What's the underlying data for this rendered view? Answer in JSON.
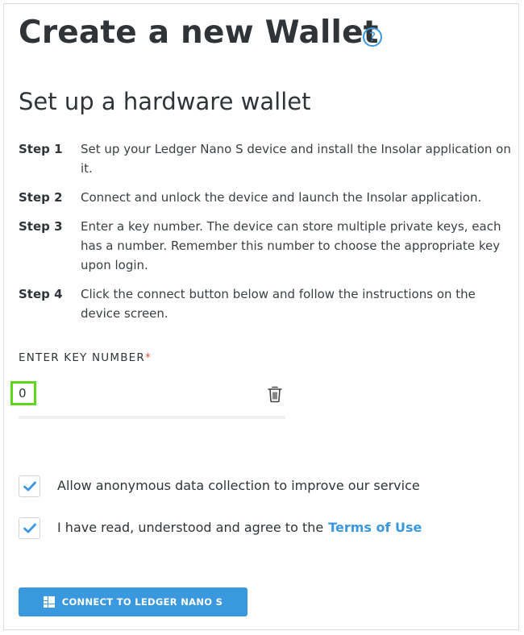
{
  "header": {
    "title": "Create a new Wallet",
    "help_icon_glyph": "?",
    "help_icon": "question-circle-icon"
  },
  "section": {
    "title": "Set up a hardware wallet"
  },
  "steps": [
    {
      "label": "Step 1",
      "text": "Set up your Ledger Nano S device and install the Insolar application on it."
    },
    {
      "label": "Step 2",
      "text": "Connect and unlock the device and launch the Insolar application."
    },
    {
      "label": "Step 3",
      "text": "Enter a key number. The device can store multiple private keys, each has a number. Remember this number to choose the appropriate key upon login."
    },
    {
      "label": "Step 4",
      "text": "Click the connect button below and follow the instructions on the device screen."
    }
  ],
  "key_field": {
    "label": "ENTER KEY NUMBER",
    "required_mark": "*",
    "value": "0",
    "clear_icon": "trash-icon"
  },
  "checkboxes": [
    {
      "label": "Allow anonymous data collection to improve our service",
      "checked": true
    },
    {
      "label": "I have read, understood and agree to the",
      "link": "Terms of Use",
      "checked": true
    }
  ],
  "connect_button": {
    "label": "CONNECT TO LEDGER NANO S",
    "icon": "ledger-icon"
  },
  "colors": {
    "accent": "#3a98de",
    "required": "#e04b3c",
    "focus_highlight": "#5fd81b",
    "text": "#2f3439"
  }
}
